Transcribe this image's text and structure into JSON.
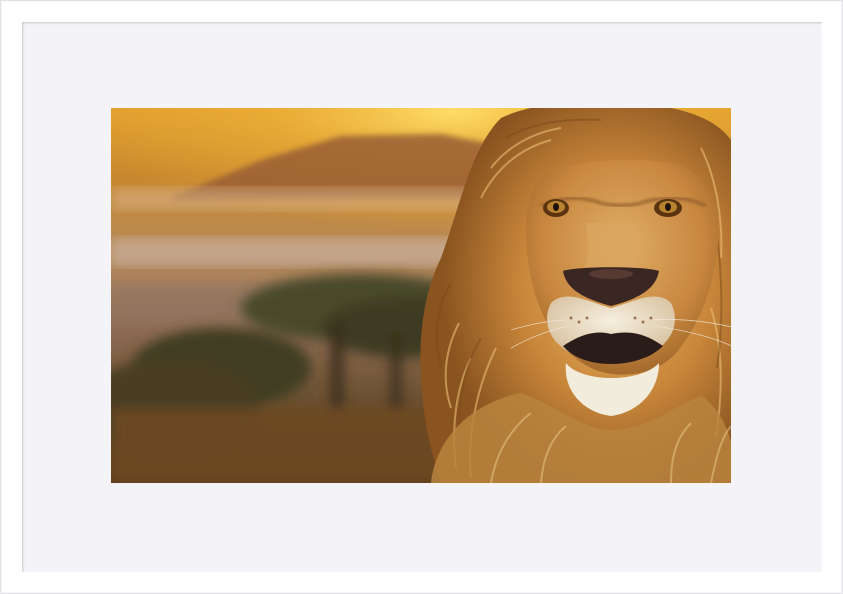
{
  "artwork": {
    "subject": "lion-portrait-savanna",
    "colors": {
      "frame": "#ffffff",
      "mat": "#f3f3f8",
      "sky_top": "#f6c23a",
      "sky_mid": "#c9822c",
      "mountain": "#9a5a34",
      "haze": "#c9b2a0",
      "tree": "#3f3a24",
      "ground": "#6b4a22",
      "mane_light": "#e8b25a",
      "mane_dark": "#8a5a22",
      "face": "#d49a52",
      "muzzle": "#f1ead8",
      "nose": "#3a2622",
      "eye": "#b07a2a"
    }
  }
}
